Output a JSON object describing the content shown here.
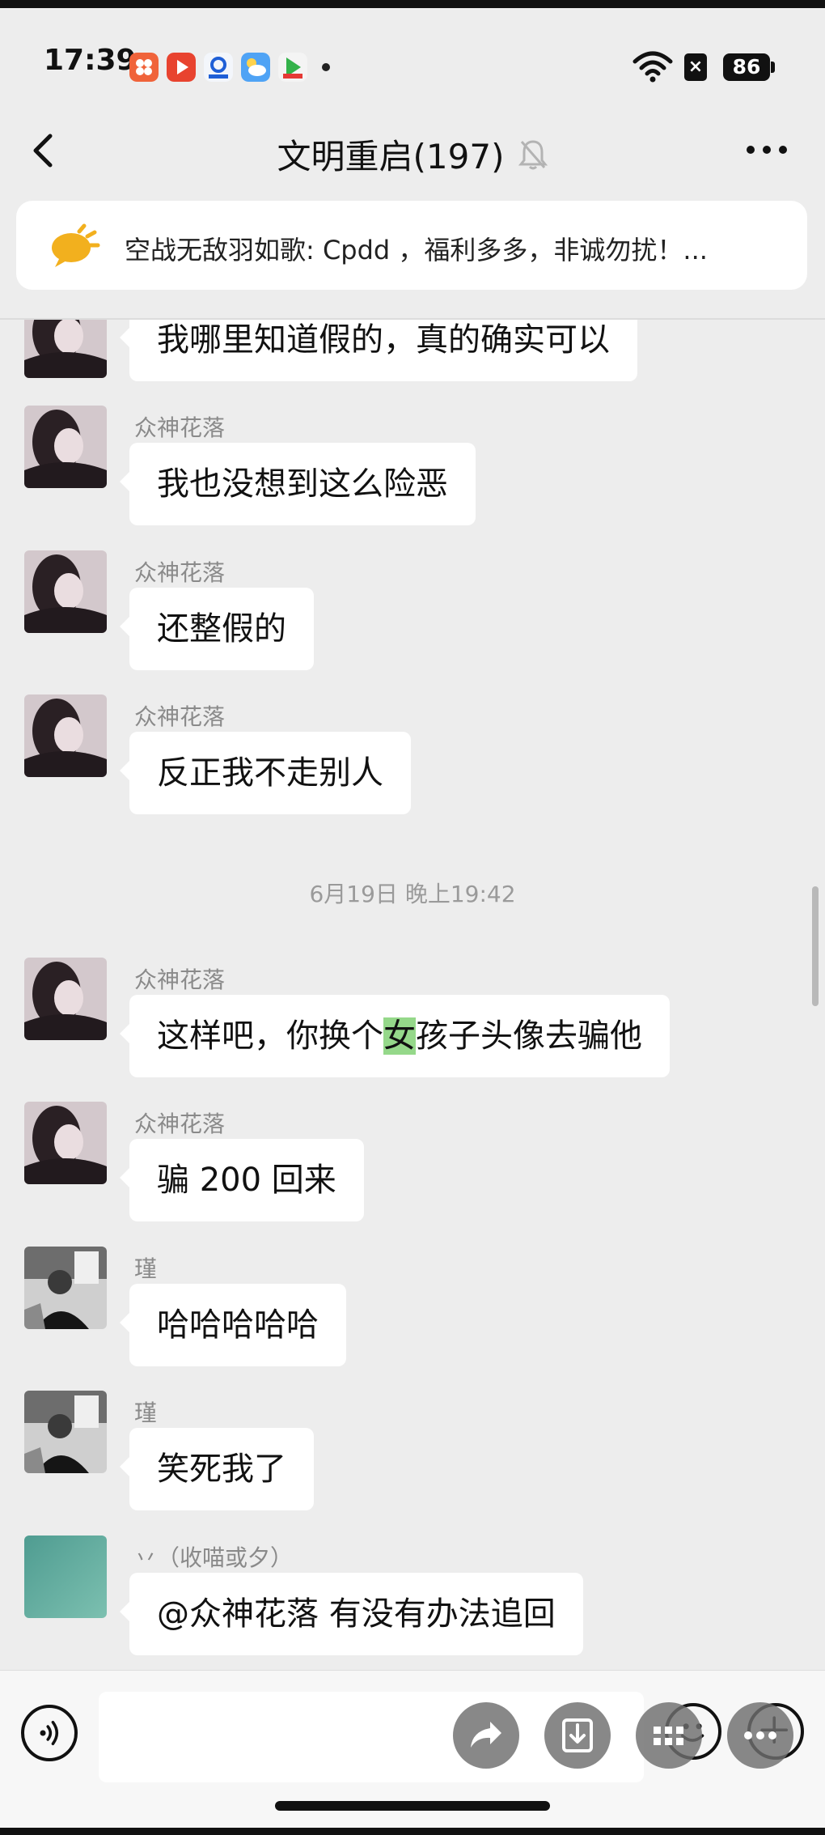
{
  "status_bar": {
    "time": "17:39",
    "battery": "86",
    "x_badge": "×",
    "app_icons": [
      "app-icon-orange-grid",
      "app-icon-red-play",
      "app-icon-blue-search",
      "app-icon-weather",
      "app-icon-video"
    ],
    "icons": [
      "wifi-icon",
      "battery-icon"
    ]
  },
  "header": {
    "title": "文明重启(197)",
    "icons": [
      "back-icon",
      "muted-bell-icon",
      "more-icon"
    ]
  },
  "pinned": {
    "text": "空战无敌羽如歌: Cpdd ，福利多多，非诚勿扰！...",
    "icon": "announcement-icon"
  },
  "messages": [
    {
      "sender": "",
      "text": "我哪里知道假的，真的确实可以"
    },
    {
      "sender": "众神花落",
      "text": "我也没想到这么险恶"
    },
    {
      "sender": "众神花落",
      "text": "还整假的"
    },
    {
      "sender": "众神花落",
      "text": "反正我不走别人"
    },
    {
      "sender": "众神花落",
      "text_before": "这样吧，你换个",
      "text_highlight": "女",
      "text_after": "孩子头像去骗他"
    },
    {
      "sender": "众神花落",
      "text": "骗 200 回来"
    },
    {
      "sender": "瑾",
      "text": "哈哈哈哈哈"
    },
    {
      "sender": "瑾",
      "text": "笑死我了"
    },
    {
      "sender": "丷（收喵或夕）",
      "text": "@众神花落  有没有办法追回"
    }
  ],
  "timestamp": "6月19日 晚上19:42",
  "colors": {
    "background": "#ededed",
    "bubble": "#ffffff",
    "highlight": "#95d88a",
    "sender": "#8a8a8a"
  },
  "input": {
    "placeholder": "",
    "icons": [
      "voice-icon",
      "emoji-icon",
      "plus-icon"
    ]
  },
  "floating_actions": [
    "forward-icon",
    "download-icon",
    "grid-icon",
    "ellipsis-icon"
  ]
}
